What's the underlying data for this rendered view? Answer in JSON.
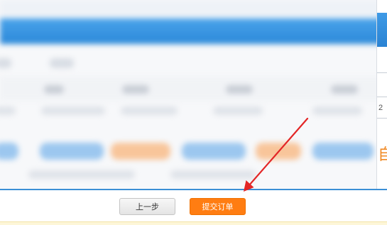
{
  "side_panel": {
    "digit": "2",
    "accent_char": "自"
  },
  "actions": {
    "prev_label": "上一步",
    "submit_label": "提交订单"
  },
  "colors": {
    "header_blue": "#2b88d9",
    "submit_orange": "#ff7d12",
    "arrow_red": "#e32626",
    "notice_yellow": "#fdf6d8"
  },
  "icons": {
    "annotation": "red-arrow-icon"
  }
}
